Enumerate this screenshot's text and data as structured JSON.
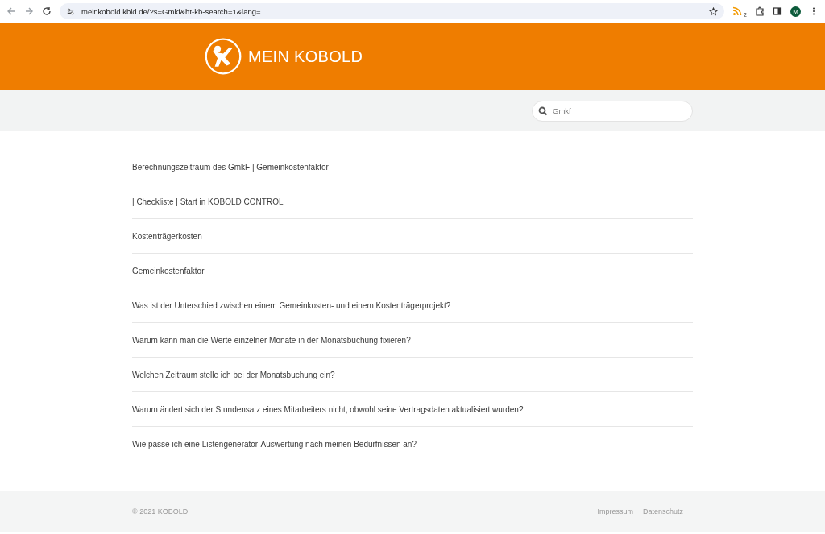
{
  "browser": {
    "url": "meinkobold.kbld.de/?s=Gmkf&ht-kb-search=1&lang=",
    "extension_badge": "2",
    "profile_initial": "M"
  },
  "header": {
    "logo_text": "MEIN KOBOLD"
  },
  "search": {
    "value": "Gmkf"
  },
  "results": [
    {
      "title": "Berechnungszeitraum des GmkF | Gemeinkostenfaktor"
    },
    {
      "title": "| Checkliste | Start in KOBOLD CONTROL"
    },
    {
      "title": "Kostenträgerkosten"
    },
    {
      "title": "Gemeinkostenfaktor"
    },
    {
      "title": "Was ist der Unterschied zwischen einem Gemeinkosten- und einem Kostenträgerprojekt?"
    },
    {
      "title": "Warum kann man die Werte einzelner Monate in der Monatsbuchung fixieren?"
    },
    {
      "title": "Welchen Zeitraum stelle ich bei der Monatsbuchung ein?"
    },
    {
      "title": "Warum ändert sich der Stundensatz eines Mitarbeiters nicht, obwohl seine Vertragsdaten aktualisiert wurden?"
    },
    {
      "title": "Wie passe ich eine Listengenerator-Auswertung nach meinen Bedürfnissen an?"
    }
  ],
  "footer": {
    "copyright": "© 2021 KOBOLD",
    "links": [
      "Impressum",
      "Datenschutz"
    ]
  }
}
